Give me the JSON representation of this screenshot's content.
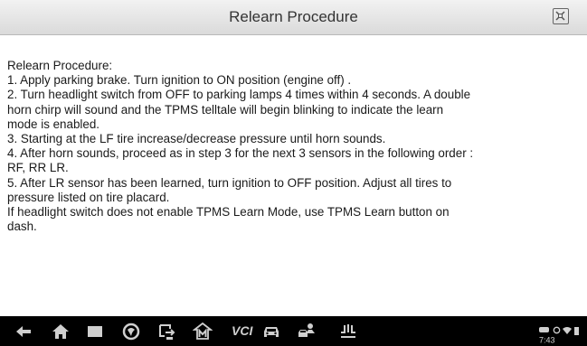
{
  "header": {
    "title": "Relearn Procedure"
  },
  "procedure": {
    "lines": [
      "Relearn Procedure:",
      "1. Apply parking brake. Turn ignition to ON position (engine off) .",
      "2. Turn headlight switch from OFF to parking lamps 4 times within 4 seconds. A double",
      "horn chirp will sound and the TPMS telltale will begin blinking to indicate the learn",
      "mode is enabled.",
      "3. Starting at the LF tire increase/decrease pressure until horn sounds.",
      "4. After horn sounds, proceed as in step 3 for the next 3 sensors in the following order :",
      "RF, RR LR.",
      "5. After LR sensor has been learned, turn ignition to OFF position. Adjust all tires to",
      "pressure listed on tire placard.",
      "If headlight switch does not enable TPMS Learn Mode, use TPMS Learn button on",
      "dash."
    ]
  },
  "navbar": {
    "vci_label": "VCI",
    "icons": [
      "back-icon",
      "home-icon",
      "recent-apps-icon",
      "browser-icon",
      "switch-icon",
      "autel-logo-icon",
      "vci-icon",
      "car-icon",
      "remote-desk-icon",
      "recycle-icon"
    ]
  },
  "status_bar": {
    "time": "7:43"
  },
  "colors": {
    "titlebar": "#e6e6e6",
    "navbar": "#000000",
    "text": "#1a1a1a",
    "icon": "#cfcfcf"
  }
}
